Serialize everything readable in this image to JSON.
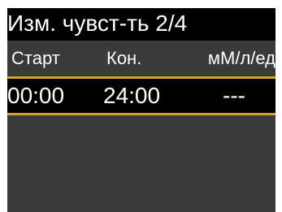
{
  "header": {
    "title": "Изм. чувст-ть 2/4"
  },
  "table": {
    "columns": {
      "start": "Старт",
      "end": "Кон.",
      "unit": "мМ/л/ед"
    },
    "rows": [
      {
        "start": "00:00",
        "end": "24:00",
        "value": "---"
      }
    ]
  },
  "colors": {
    "background": "#000000",
    "panel": "#3a3a3a",
    "accent": "#d3a12a",
    "text": "#ffffff"
  }
}
